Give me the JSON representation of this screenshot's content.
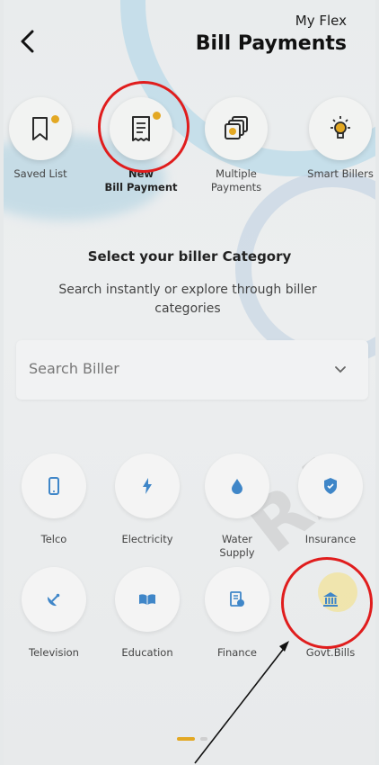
{
  "header": {
    "subtitle": "My Flex",
    "title": "Bill Payments"
  },
  "quick_actions": [
    {
      "label": "Saved List",
      "icon": "bookmark-icon"
    },
    {
      "label_line1": "New",
      "label_line2": "Bill Payment",
      "icon": "receipt-icon",
      "active": true
    },
    {
      "label_line1": "Multiple",
      "label_line2": "Payments",
      "icon": "stacked-cards-icon"
    },
    {
      "label": "Smart Billers",
      "icon": "lightbulb-icon"
    }
  ],
  "main": {
    "heading": "Select your biller Category",
    "description": "Search instantly or explore through biller categories"
  },
  "search": {
    "placeholder": "Search Biller"
  },
  "categories": [
    {
      "label": "Telco",
      "icon": "phone-icon"
    },
    {
      "label": "Electricity",
      "icon": "lightning-icon"
    },
    {
      "label_line1": "Water",
      "label_line2": "Supply",
      "icon": "water-drop-icon"
    },
    {
      "label": "Insurance",
      "icon": "shield-icon"
    },
    {
      "label": "Television",
      "icon": "satellite-dish-icon"
    },
    {
      "label": "Education",
      "icon": "open-book-icon"
    },
    {
      "label": "Finance",
      "icon": "finance-document-icon"
    },
    {
      "label": "Govt.Bills",
      "icon": "government-building-icon"
    }
  ],
  "colors": {
    "accent": "#e3a823",
    "icon_blue": "#3f86c8",
    "annotation_red": "#e01d1d"
  }
}
